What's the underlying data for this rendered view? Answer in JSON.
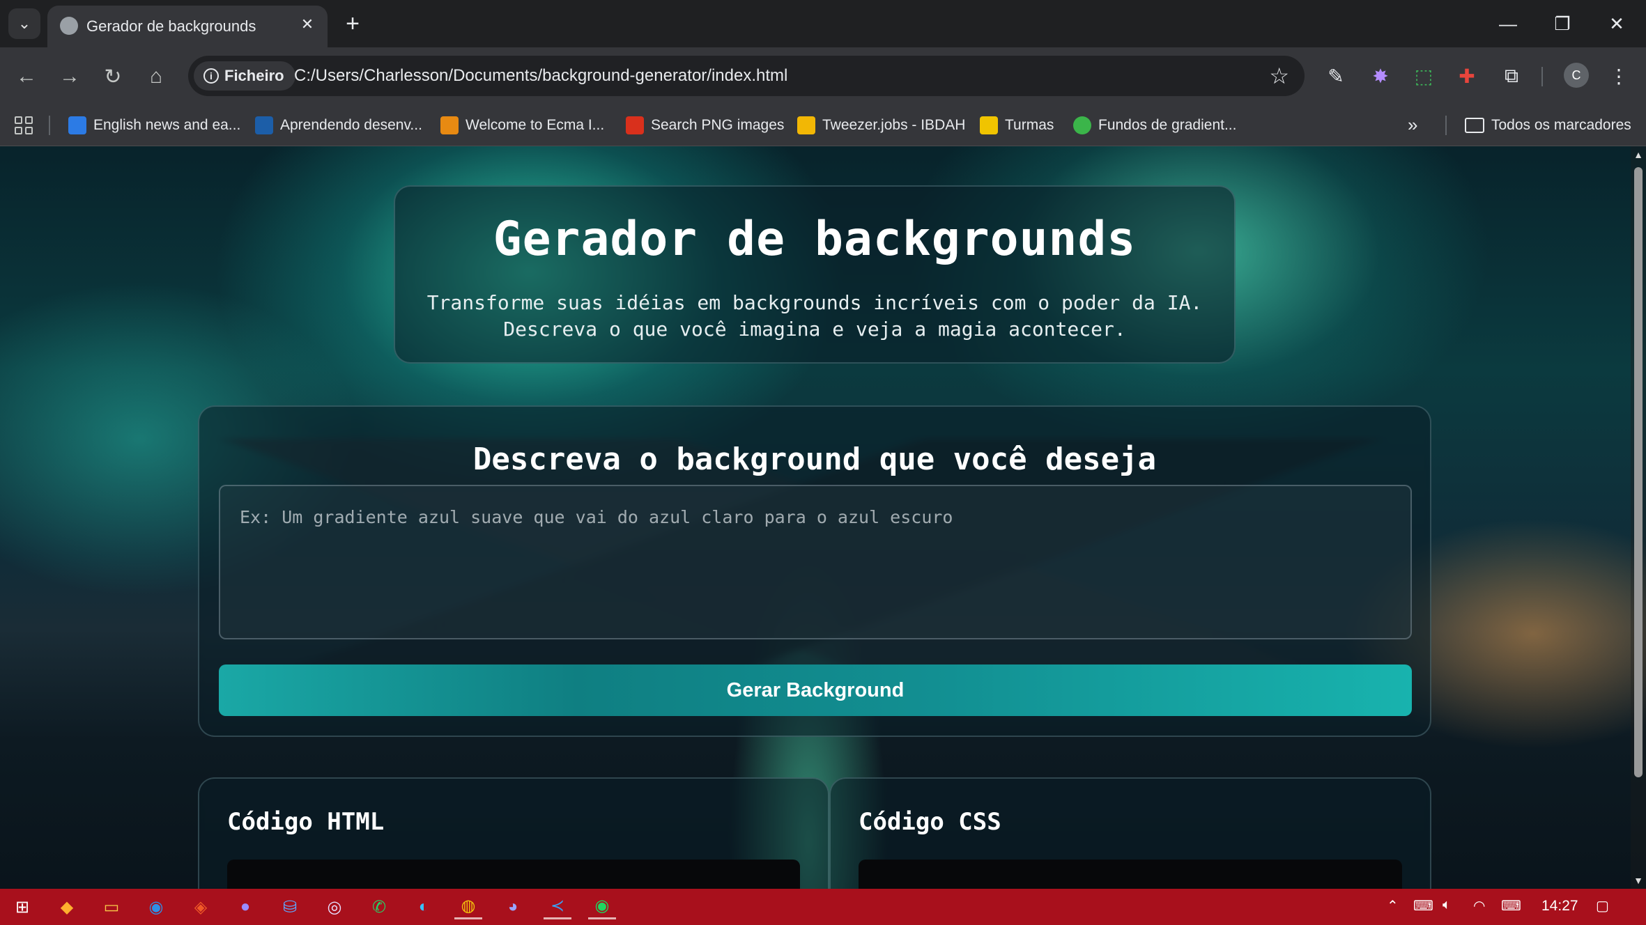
{
  "browser": {
    "tab_title": "Gerador de backgrounds",
    "new_tab_label": "+",
    "chip_label": "Ficheiro",
    "url": "C:/Users/Charlesson/Documents/background-generator/index.html",
    "profile_initial": "C",
    "bookmarks": [
      {
        "label": "English news and ea...",
        "color": "#2c7be5"
      },
      {
        "label": "Aprendendo desenv...",
        "color": "#1c5ea8"
      },
      {
        "label": "Welcome to Ecma I...",
        "color": "#e88a12"
      },
      {
        "label": "Search PNG images",
        "color": "#d9301c"
      },
      {
        "label": "Tweezer.jobs - IBDAH",
        "color": "#f2b705"
      },
      {
        "label": "Turmas",
        "color": "#f0c400"
      },
      {
        "label": "Fundos de gradient...",
        "color": "#3bb54a"
      }
    ],
    "all_bookmarks_label": "Todos os marcadores",
    "more_bookmarks": "»"
  },
  "page": {
    "title": "Gerador de backgrounds",
    "subtitle_line1": "Transforme suas idéias em backgrounds incríveis com o poder da IA.",
    "subtitle_line2": "Descreva o que você imagina e veja a magia acontecer.",
    "form_title": "Descreva o background que você deseja",
    "prompt_placeholder": "Ex: Um gradiente azul suave que vai do azul claro para o azul escuro",
    "generate_button": "Gerar Background",
    "html_code_title": "Código HTML",
    "css_code_title": "Código CSS"
  },
  "taskbar": {
    "time": "14:27"
  },
  "colors": {
    "accent_button": "#18b3ae",
    "taskbar": "#a8101c",
    "chrome_bg": "#35363a"
  }
}
